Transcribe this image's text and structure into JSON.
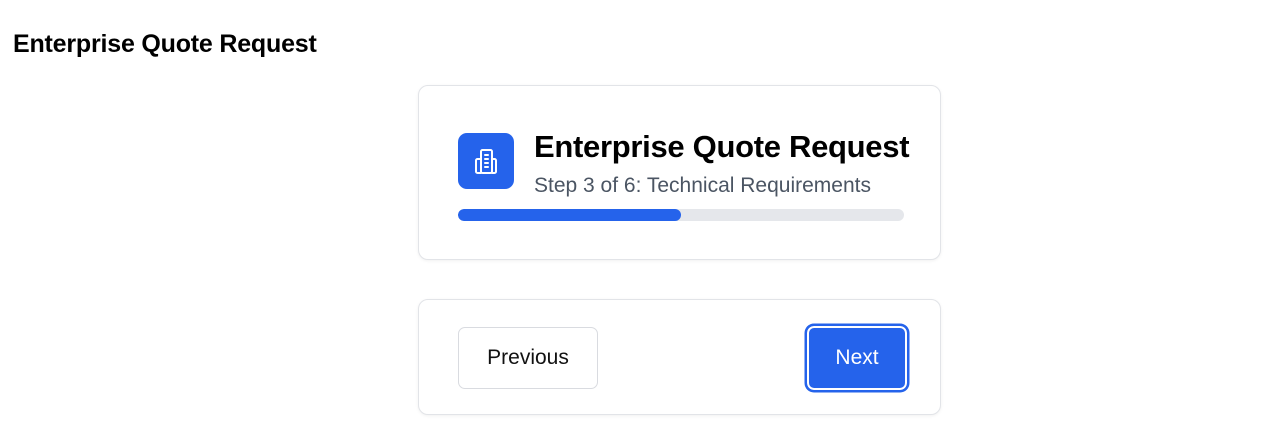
{
  "page": {
    "heading": "Enterprise Quote Request"
  },
  "header_card": {
    "icon": "building-icon",
    "title": "Enterprise Quote Request",
    "subtitle": "Step 3 of 6: Technical Requirements",
    "progress_fraction": 0.5,
    "accent_color": "#2563eb"
  },
  "navigation": {
    "previous_label": "Previous",
    "next_label": "Next"
  }
}
